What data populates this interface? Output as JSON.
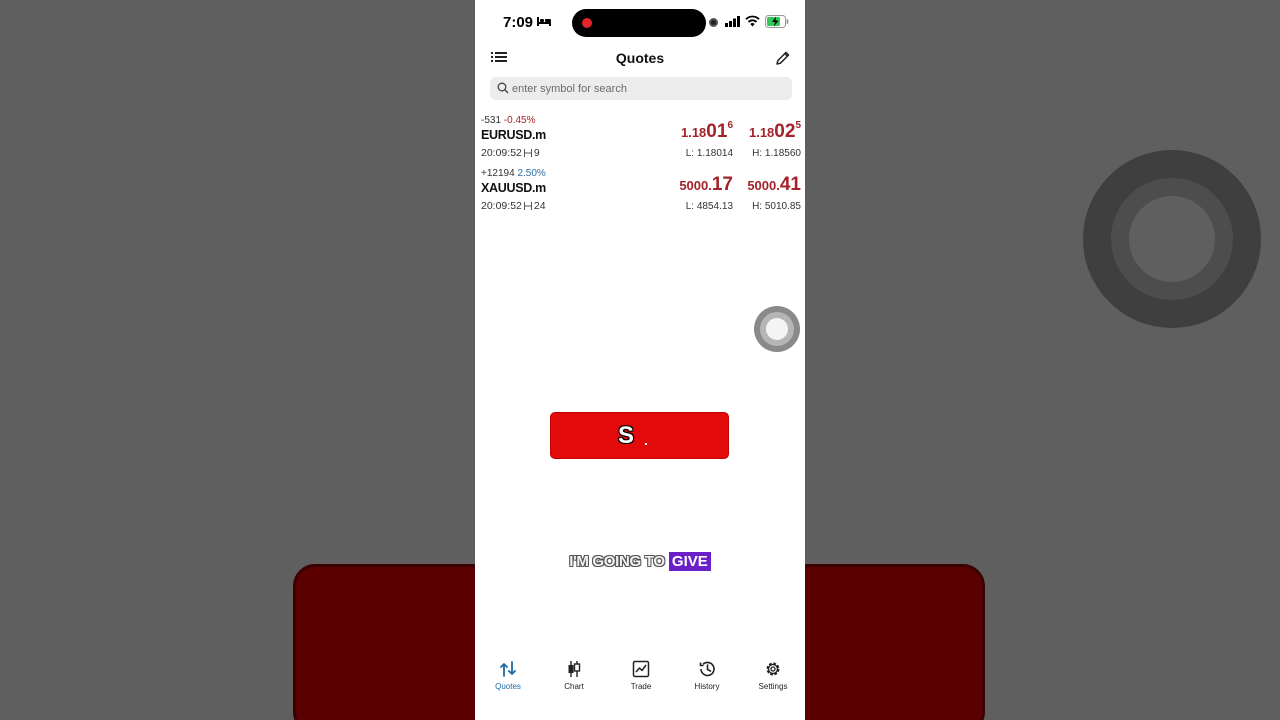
{
  "status_bar": {
    "time": "7:09"
  },
  "nav": {
    "title": "Quotes"
  },
  "search": {
    "placeholder": "enter symbol for search"
  },
  "quotes": [
    {
      "change_points": "-531",
      "change_percent": "-0.45%",
      "symbol": "EURUSD.m",
      "time": "20:09:52",
      "spread": "9",
      "bid_prefix": "1.18",
      "bid_big": "01",
      "bid_sup": "6",
      "ask_prefix": "1.18",
      "ask_big": "02",
      "ask_sup": "5",
      "low": "L: 1.18014",
      "high": "H: 1.18560"
    },
    {
      "change_points": "+12194",
      "change_percent": "2.50%",
      "symbol": "XAUUSD.m",
      "time": "20:09:52",
      "spread": "24",
      "bid_prefix": "5000.",
      "bid_big": "17",
      "bid_sup": "",
      "ask_prefix": "5000.",
      "ask_big": "41",
      "ask_sup": "",
      "low": "L: 4854.13",
      "high": "H: 5010.85"
    }
  ],
  "overlay": {
    "banner_text": "S",
    "caption_words": "I'M GOING TO",
    "caption_highlight": "GIVE"
  },
  "tabs": [
    {
      "label": "Quotes",
      "icon": "quotes-arrows-icon",
      "active": true
    },
    {
      "label": "Chart",
      "icon": "candlestick-icon",
      "active": false
    },
    {
      "label": "Trade",
      "icon": "trade-chart-icon",
      "active": false
    },
    {
      "label": "History",
      "icon": "history-clock-icon",
      "active": false
    },
    {
      "label": "Settings",
      "icon": "gear-icon",
      "active": false
    }
  ],
  "colors": {
    "price_red": "#a4232a",
    "accent_blue": "#1e6aa5",
    "banner_red": "#e20a0a",
    "caption_purple": "#6a1fc9"
  }
}
